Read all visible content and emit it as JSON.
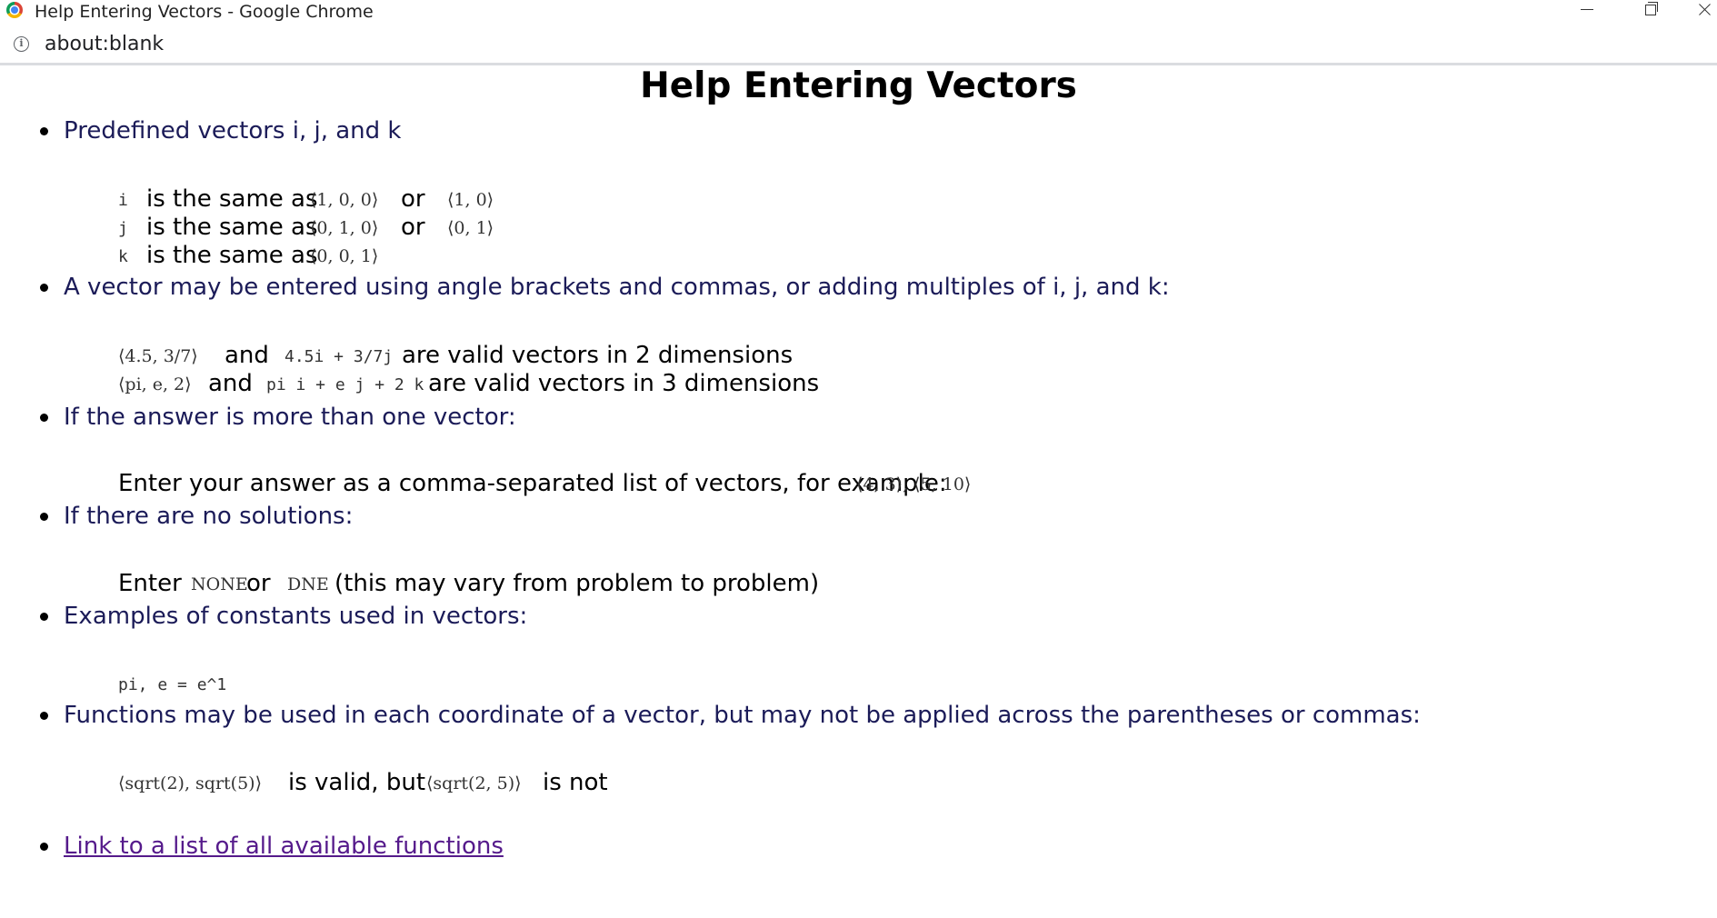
{
  "window": {
    "title": "Help Entering Vectors - Google Chrome"
  },
  "address_bar": {
    "url": "about:blank"
  },
  "page": {
    "heading": "Help Entering Vectors",
    "sections": [
      {
        "bullet": "Predefined vectors i, j, and k",
        "rows": [
          {
            "name": "i",
            "same_as": "is the same as",
            "form1": "⟨1, 0, 0⟩",
            "or": "or",
            "form2": "⟨1, 0⟩"
          },
          {
            "name": "j",
            "same_as": "is the same as",
            "form1": "⟨0, 1, 0⟩",
            "or": "or",
            "form2": "⟨0, 1⟩"
          },
          {
            "name": "k",
            "same_as": "is the same as",
            "form1": "⟨0, 0, 1⟩"
          }
        ]
      },
      {
        "bullet": "A vector may be entered using angle brackets and commas, or adding multiples of i, j, and k:",
        "rows": [
          {
            "ex1": "⟨4.5, 3/7⟩",
            "and": "and",
            "ex2": "4.5i + 3/7j",
            "desc": "are valid vectors in 2 dimensions"
          },
          {
            "ex1": "⟨pi, e, 2⟩",
            "and": "and",
            "ex2": "pi i + e j + 2 k",
            "desc": "are valid vectors in 3 dimensions"
          }
        ]
      },
      {
        "bullet": "If the answer is more than one vector:",
        "text": "Enter your answer as a comma-separated list of vectors, for example:",
        "example": "⟨4, 3⟩, ⟨5, 10⟩"
      },
      {
        "bullet": "If there are no solutions:",
        "enter": "Enter",
        "none": "NONE",
        "or": "or",
        "dne": "DNE",
        "note": "(this may vary from problem to problem)"
      },
      {
        "bullet": "Examples of constants used in vectors:",
        "example": "pi, e = e^1"
      },
      {
        "bullet": "Functions may be used in each coordinate of a vector, but may not be applied across the parentheses or commas:",
        "valid_example": "⟨sqrt(2), sqrt(5)⟩",
        "valid_text": "is valid, but",
        "invalid_example": "⟨sqrt(2, 5)⟩",
        "invalid_text": "is not"
      }
    ],
    "link": {
      "label": "Link to a list of all available functions"
    }
  },
  "colors": {
    "bullet_text": "#1b1b58",
    "link": "#551a8b"
  },
  "icons": {
    "browser": "chrome-logo-icon",
    "address_info": "info-icon"
  }
}
